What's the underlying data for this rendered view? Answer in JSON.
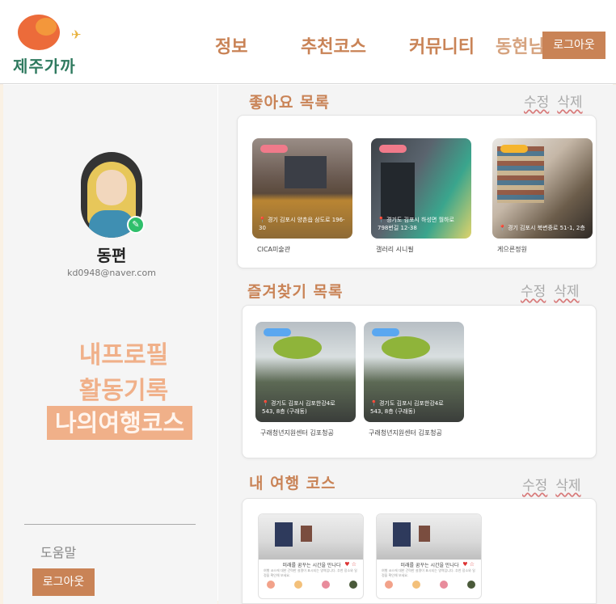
{
  "header": {
    "logo_text": "제주가까",
    "nav": {
      "info": "정보",
      "course": "추천코스",
      "community": "커뮤니티",
      "user": "동현님"
    },
    "logout": "로그아웃"
  },
  "profile": {
    "name": "동편",
    "email": "kd0948@naver.com",
    "edit_icon": "pencil-icon"
  },
  "sidebar": {
    "menu": {
      "profile": "내프로필",
      "activity": "활동기록",
      "mycourse": "나의여행코스"
    },
    "help": "도움말",
    "logout": "로그아웃"
  },
  "sections": {
    "likes": {
      "title": "좋아요 목록",
      "edit": "수정",
      "delete": "삭제",
      "items": [
        {
          "name": "CICA미술관",
          "address": "경기 김포시 양촌읍 삼도로 196-30",
          "tag_color": "#f07a8a"
        },
        {
          "name": "갤러리 시니필",
          "address": "경기도 김포시 하성면 월하로 798번길 12-38",
          "tag_color": "#f07a8a"
        },
        {
          "name": "게으른정원",
          "address": "경기 김포시 북변중로 51-1, 2층",
          "tag_color": "#f5b52e"
        }
      ]
    },
    "favorites": {
      "title": "즐겨찾기 목록",
      "edit": "수정",
      "delete": "삭제",
      "items": [
        {
          "name": "구래청년지원센터 김포청공",
          "address": "경기도 김포시 김포한강4로 543, 8층 (구래동)",
          "tag_color": "#5aa7f0"
        },
        {
          "name": "구래청년지원센터 김포청공",
          "address": "경기도 김포시 김포한강4로 543, 8층 (구래동)",
          "tag_color": "#5aa7f0"
        }
      ]
    },
    "courses": {
      "title": "내 여행 코스",
      "edit": "수정",
      "delete": "삭제",
      "items": [
        {
          "title": "미래를 꿈꾸는 시간을 만나다",
          "heart": "♥ ☆",
          "desc": "여행 코스에 대한 간략한 설명이 표시되는 영역입니다. 추천 장소와 일정을 확인해 보세요."
        },
        {
          "title": "미래를 꿈꾸는 시간을 만나다",
          "heart": "♥ ☆",
          "desc": "여행 코스에 대한 간략한 설명이 표시되는 영역입니다. 추천 장소와 일정을 확인해 보세요."
        }
      ]
    }
  },
  "colors": {
    "accent": "#c98356",
    "menu_text": "#f0b089",
    "brand_green": "#2f7a5f"
  }
}
